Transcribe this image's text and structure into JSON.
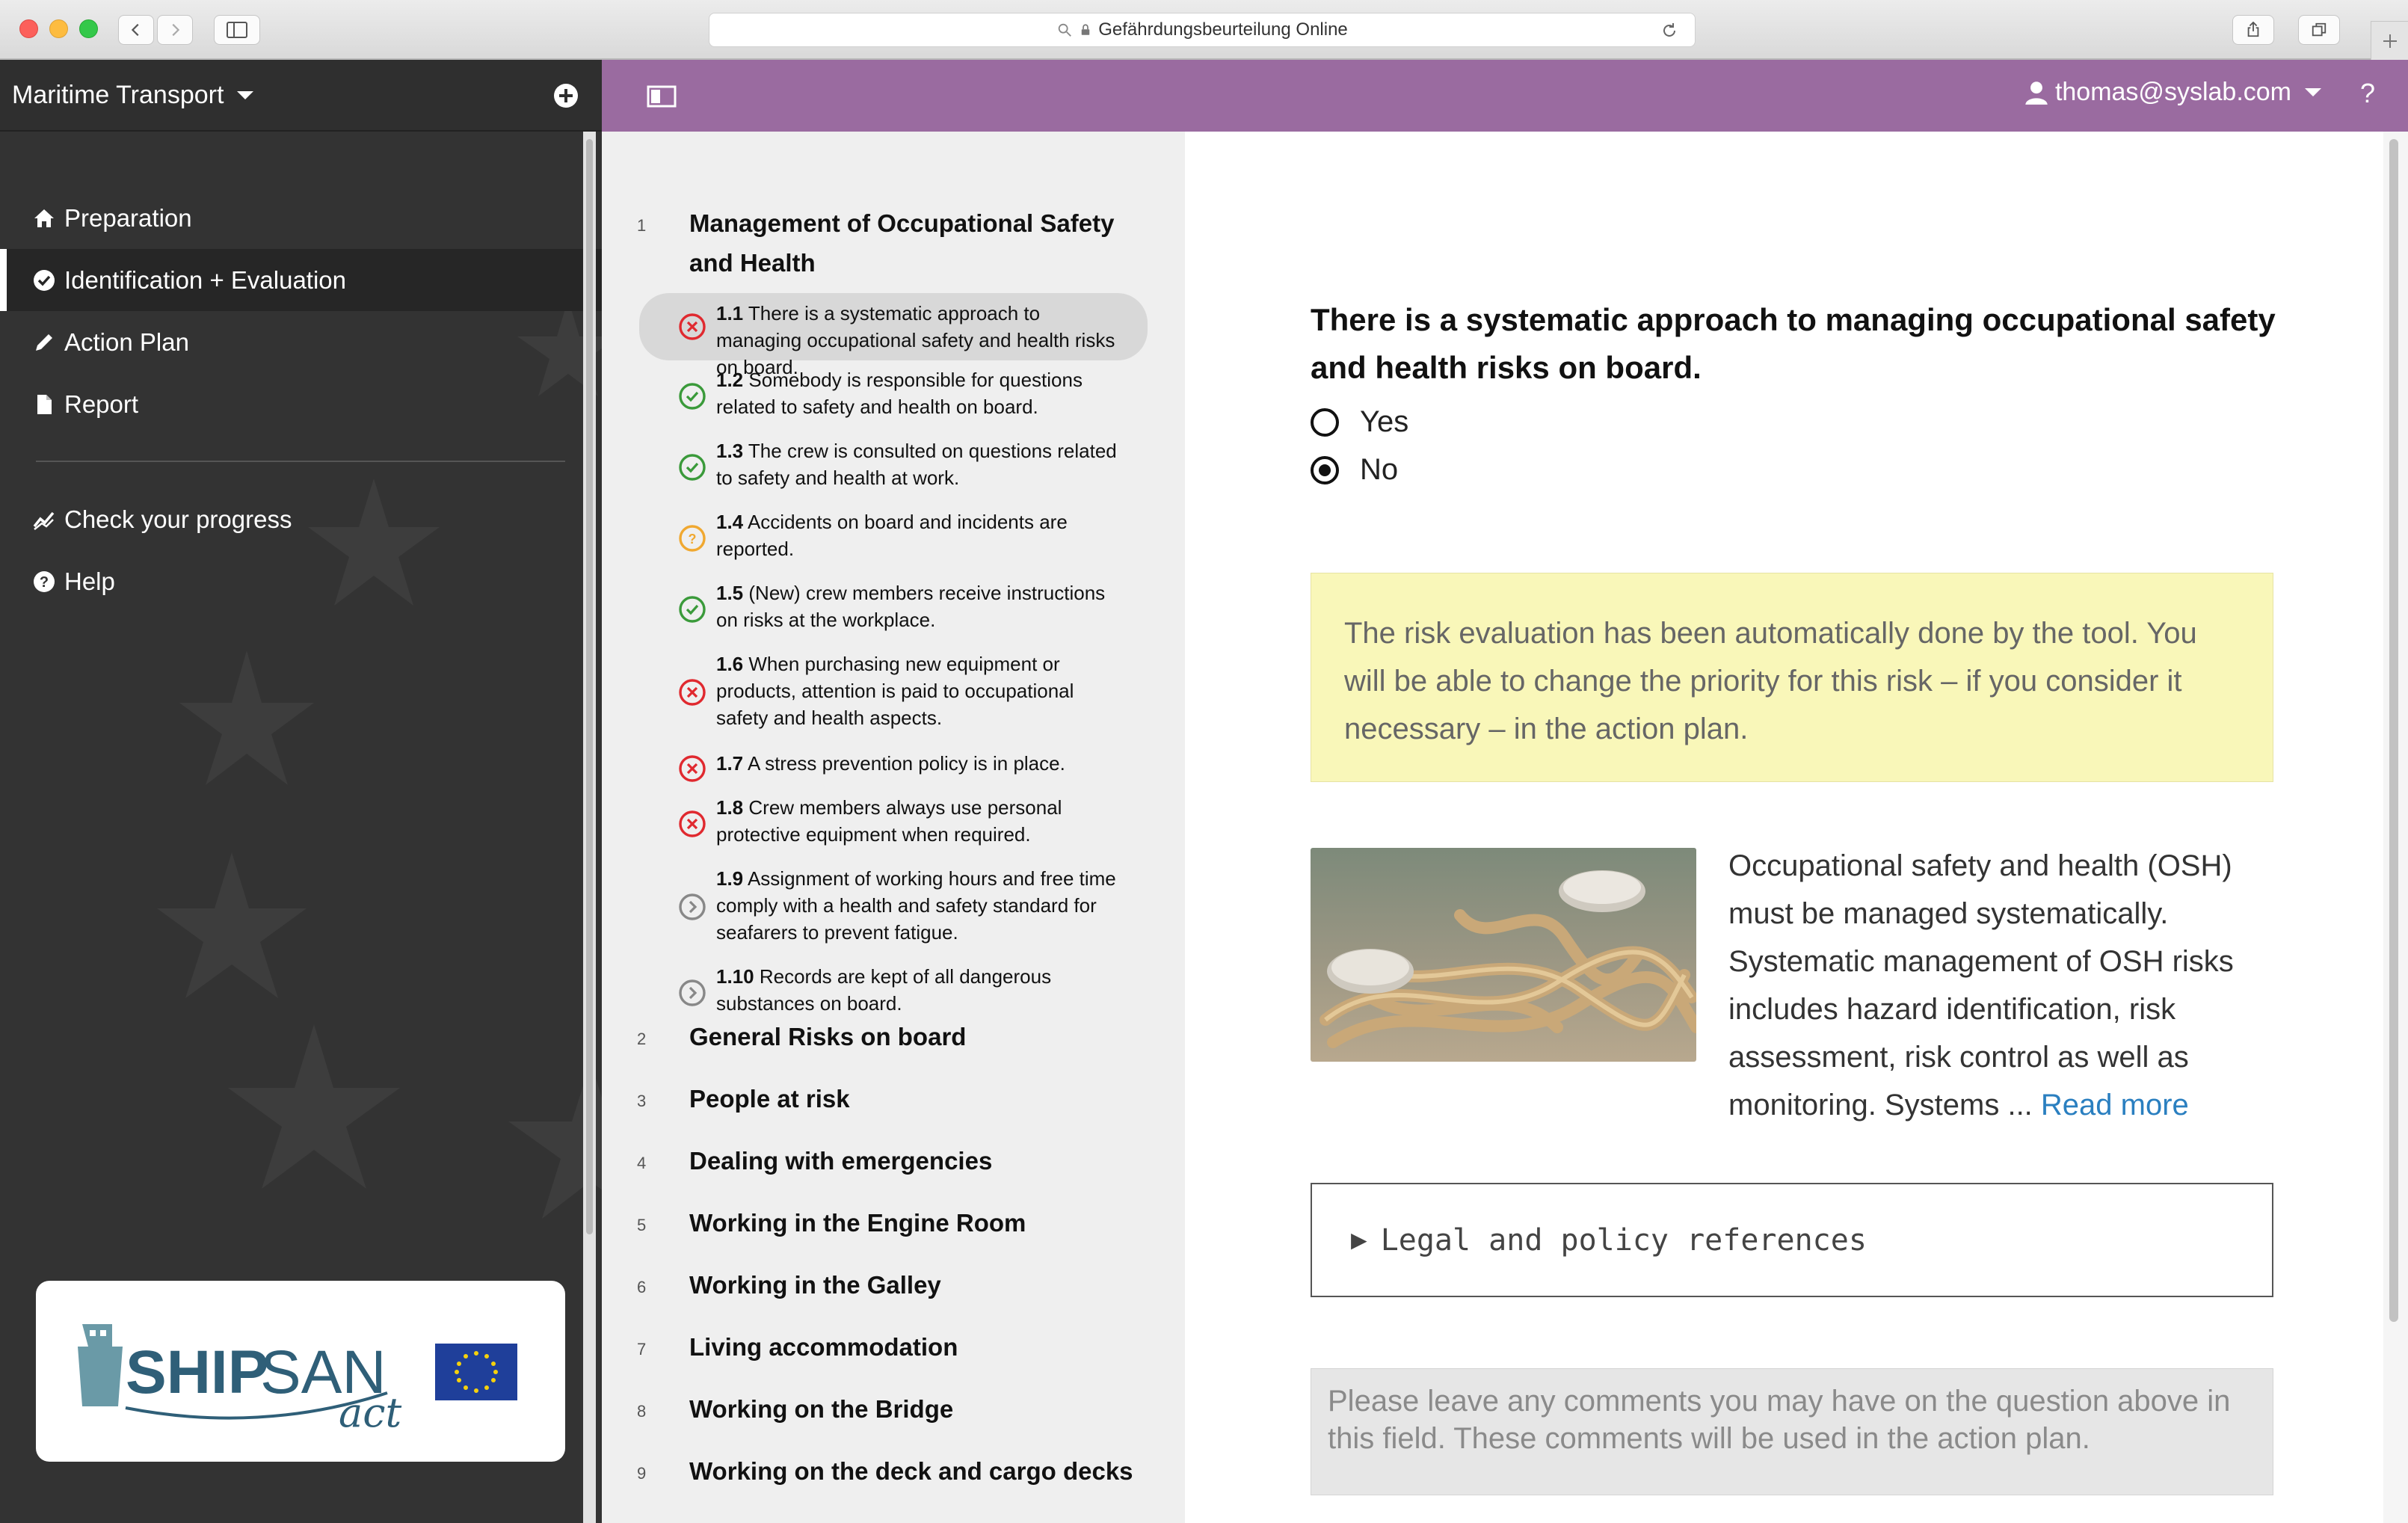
{
  "browser": {
    "address": "Gefährdungsbeurteilung Online"
  },
  "sidebar": {
    "tool_name": "Maritime Transport",
    "menu": [
      {
        "label": "Preparation",
        "icon": "home-icon"
      },
      {
        "label": "Identification + Evaluation",
        "icon": "check-circle-icon"
      },
      {
        "label": "Action Plan",
        "icon": "pencil-icon"
      },
      {
        "label": "Report",
        "icon": "document-icon"
      }
    ],
    "menu2": [
      {
        "label": "Check your progress",
        "icon": "chart-icon"
      },
      {
        "label": "Help",
        "icon": "question-circle-icon"
      }
    ]
  },
  "header": {
    "user": "thomas@syslab.com",
    "help": "?"
  },
  "tree": {
    "sections": [
      {
        "number": "1",
        "title": "Management of Occupational Safety and Health"
      },
      {
        "number": "2",
        "title": "General Risks on board"
      },
      {
        "number": "3",
        "title": "People at risk"
      },
      {
        "number": "4",
        "title": "Dealing with emergencies"
      },
      {
        "number": "5",
        "title": "Working in the Engine Room"
      },
      {
        "number": "6",
        "title": "Working in the Galley"
      },
      {
        "number": "7",
        "title": "Living accommodation"
      },
      {
        "number": "8",
        "title": "Working on the Bridge"
      },
      {
        "number": "9",
        "title": "Working on the deck and cargo decks"
      }
    ],
    "questions": [
      {
        "number": "1.1",
        "text": "There is a systematic approach to managing occupational safety and health risks on board.",
        "status": "risk"
      },
      {
        "number": "1.2",
        "text": "Somebody is responsible for questions related to safety and health on board.",
        "status": "ok"
      },
      {
        "number": "1.3",
        "text": "The crew is consulted on questions related to safety and health at work.",
        "status": "ok"
      },
      {
        "number": "1.4",
        "text": "Accidents on board and incidents are reported.",
        "status": "unknown"
      },
      {
        "number": "1.5",
        "text": "(New) crew members receive instructions on risks at the workplace.",
        "status": "ok"
      },
      {
        "number": "1.6",
        "text": "When purchasing new equipment or products, attention is paid to occupational safety and health aspects.",
        "status": "risk"
      },
      {
        "number": "1.7",
        "text": "A stress prevention policy is in place.",
        "status": "risk"
      },
      {
        "number": "1.8",
        "text": "Crew members always use personal protective equipment when required.",
        "status": "risk"
      },
      {
        "number": "1.9",
        "text": "Assignment of working hours and free time comply with a health and safety standard for seafarers to prevent fatigue.",
        "status": "open"
      },
      {
        "number": "1.10",
        "text": "Records are kept of all dangerous substances on board.",
        "status": "open"
      }
    ]
  },
  "main": {
    "question": "There is a systematic approach to managing occupational safety and health risks on board.",
    "options": [
      {
        "label": "Yes",
        "selected": false
      },
      {
        "label": "No",
        "selected": true
      }
    ],
    "info": "The risk evaluation has been automatically done by the tool. You will be able to change the priority for this risk – if you consider it necessary – in the action plan.",
    "osh": "Occupational safety and health (OSH) must be managed systematically. Systematic management of OSH risks includes hazard identification, risk assessment, risk control as well as monitoring. Systems ... ",
    "read_more": "Read more",
    "legal": "Legal and policy references",
    "comments_placeholder": "Please leave any comments you may have on the question above in this field. These comments will be used in the action plan."
  },
  "colors": {
    "header": "#9a6ba0",
    "sidebar": "#333333",
    "risk": "#e0292f",
    "ok": "#3a9a3a",
    "unknown": "#f0a830",
    "open": "#888888",
    "link": "#2a7fc0"
  },
  "logo": {
    "text_left": "SHIPSAN",
    "text_right": "act"
  }
}
